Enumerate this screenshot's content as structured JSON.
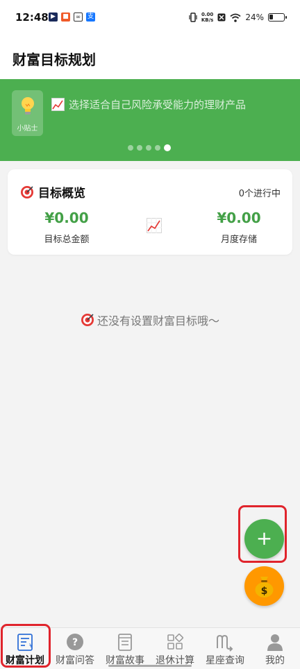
{
  "status_bar": {
    "time": "12:48",
    "net_speed_value": "0.00",
    "net_speed_unit": "KB/s",
    "battery": "24%",
    "battery_level": 0.24
  },
  "header": {
    "title": "财富目标规划"
  },
  "banner": {
    "tip_label": "小贴士",
    "tip_text": "选择适合自己风险承受能力的理财产品",
    "dot_count": 5,
    "active_dot": 4,
    "color": "#4caf50"
  },
  "overview": {
    "title": "目标概览",
    "count_text": "0个进行中",
    "total_amount": "¥0.00",
    "total_label": "目标总金额",
    "monthly_amount": "¥0.00",
    "monthly_label": "月度存储"
  },
  "empty_state": {
    "text": "还没有设置财富目标哦～"
  },
  "fab": {
    "add_label": "+"
  },
  "nav": {
    "items": [
      {
        "label": "财富计划",
        "icon": "plan-list-icon",
        "active": true
      },
      {
        "label": "财富问答",
        "icon": "question-icon",
        "active": false
      },
      {
        "label": "财富故事",
        "icon": "book-icon",
        "active": false
      },
      {
        "label": "退休计算",
        "icon": "grid-apps-icon",
        "active": false
      },
      {
        "label": "星座查询",
        "icon": "scorpio-icon",
        "active": false
      },
      {
        "label": "我的",
        "icon": "user-icon",
        "active": false
      }
    ]
  },
  "colors": {
    "accent": "#4caf50",
    "amount": "#43a047",
    "fab_secondary": "#ff9800",
    "highlight": "#e0242c"
  }
}
